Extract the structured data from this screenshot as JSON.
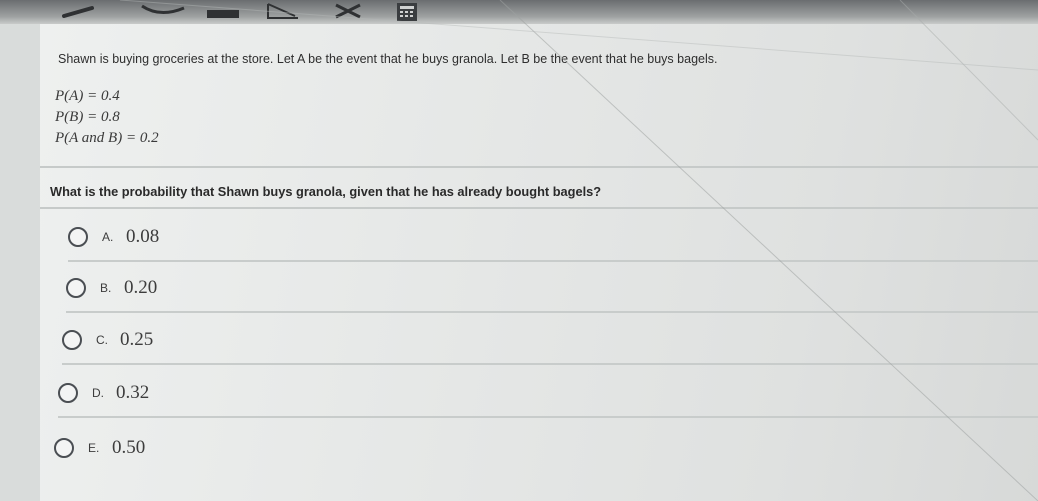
{
  "problem": {
    "stem": "Shawn is buying groceries at the store. Let A be the event that he buys granola. Let B be the event that he buys bagels.",
    "given": [
      "P(A) = 0.4",
      "P(B) = 0.8",
      "P(A and B) = 0.2"
    ],
    "question": "What is the probability that Shawn buys granola, given that he has already bought bagels?"
  },
  "options": [
    {
      "letter": "A.",
      "value": "0.08"
    },
    {
      "letter": "B.",
      "value": "0.20"
    },
    {
      "letter": "C.",
      "value": "0.25"
    },
    {
      "letter": "D.",
      "value": "0.32"
    },
    {
      "letter": "E.",
      "value": "0.50"
    }
  ],
  "toolbar": {
    "icons": [
      "pencil-icon",
      "line-icon",
      "highlighter-icon",
      "flag-icon",
      "cross-out-icon",
      "calculator-icon"
    ]
  },
  "colors": {
    "page_background": "#d9dcdb",
    "radio_border": "#4a4e53",
    "divider": "#c6cac9"
  }
}
